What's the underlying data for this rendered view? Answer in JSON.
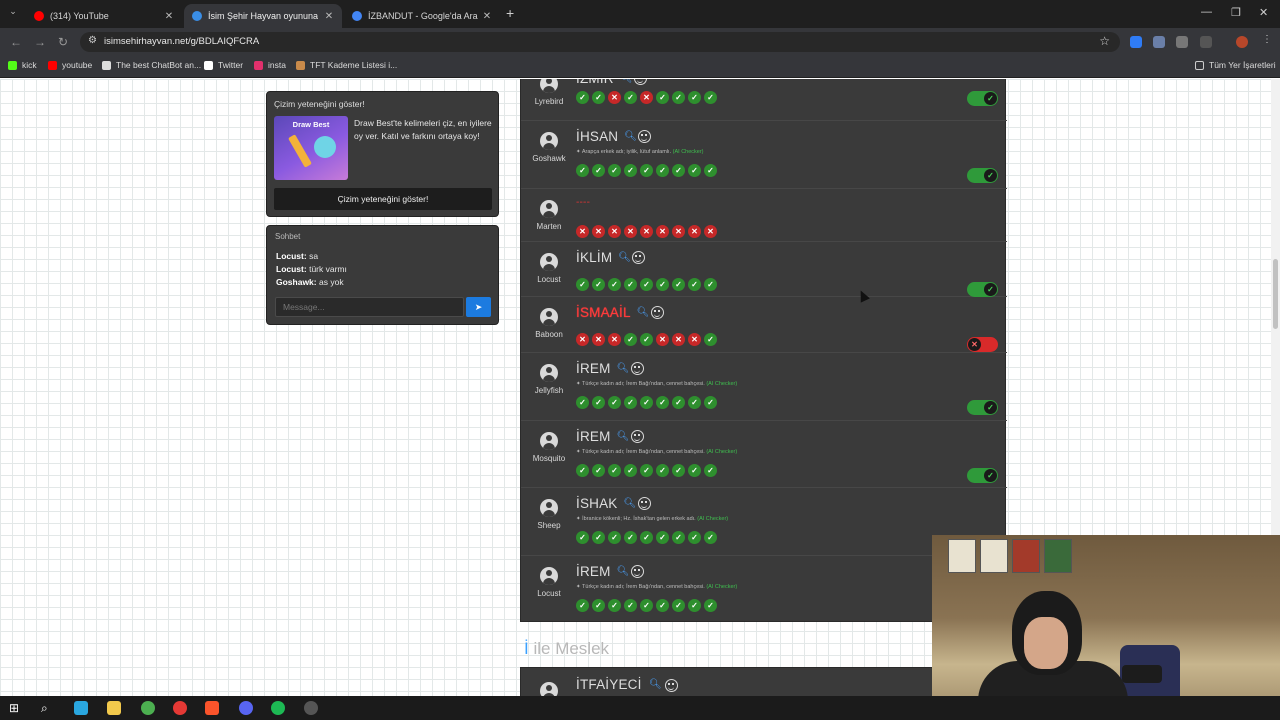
{
  "browser": {
    "tabs": [
      {
        "title": "(314) YouTube",
        "color": "#ff0000",
        "active": false
      },
      {
        "title": "İsim Şehir Hayvan oyununa katıl",
        "color": "#3a8ee6",
        "active": true
      },
      {
        "title": "İZBANDUT - Google'da Ara",
        "color": "#4285f4",
        "active": false
      }
    ],
    "new_tab": "+",
    "url": "isimsehirhayvan.net/g/BDLAIQFCRA",
    "bookmarks": [
      {
        "label": "kick",
        "color": "#53fc18"
      },
      {
        "label": "youtube",
        "color": "#ff0000"
      },
      {
        "label": "The best ChatBot an...",
        "color": "#dddddd"
      },
      {
        "label": "Twitter",
        "color": "#ffffff"
      },
      {
        "label": "insta",
        "color": "#e1306c"
      },
      {
        "label": "TFT Kademe Listesi i...",
        "color": "#c98a4a"
      }
    ],
    "all_bookmarks": "Tüm Yer İşaretleri"
  },
  "promo": {
    "title": "Çizim yeteneğini göster!",
    "image_label": "Draw Best",
    "text": "Draw Best'te kelimeleri çiz, en iyilere oy ver. Katıl ve farkını ortaya koy!",
    "button": "Çizim yeteneğini göster!"
  },
  "chat": {
    "title": "Sohbet",
    "messages": [
      {
        "user": "Locust:",
        "text": "sa"
      },
      {
        "user": "Locust:",
        "text": "türk varmı"
      },
      {
        "user": "Goshawk:",
        "text": "as yok"
      }
    ],
    "placeholder": "Message...",
    "send_icon": "send-icon"
  },
  "answers": [
    {
      "player": "Lyrebird",
      "word": "İZMİR",
      "votes": [
        "ok",
        "ok",
        "no",
        "ok",
        "no",
        "ok",
        "ok",
        "ok",
        "ok"
      ],
      "toggle": "on"
    },
    {
      "player": "Goshawk",
      "word": "İHSAN",
      "desc": "Arapça erkek adı; iyilik, lütuf anlamlı.",
      "ai": "(AI Checker)",
      "votes": [
        "ok",
        "ok",
        "ok",
        "ok",
        "ok",
        "ok",
        "ok",
        "ok",
        "ok"
      ],
      "toggle": "on"
    },
    {
      "player": "Marten",
      "word": "----",
      "empty": true,
      "votes": [
        "no",
        "no",
        "no",
        "no",
        "no",
        "no",
        "no",
        "no",
        "no"
      ],
      "toggle": ""
    },
    {
      "player": "Locust",
      "word": "İKLİM",
      "votes": [
        "ok",
        "ok",
        "ok",
        "ok",
        "ok",
        "ok",
        "ok",
        "ok",
        "ok"
      ],
      "toggle": "on"
    },
    {
      "player": "Baboon",
      "word": "İSMAAİL",
      "wrong": true,
      "votes": [
        "no",
        "no",
        "no",
        "ok",
        "ok",
        "no",
        "no",
        "no",
        "ok"
      ],
      "toggle": "off"
    },
    {
      "player": "Jellyfish",
      "word": "İREM",
      "desc": "Türkçe kadın adı; İrem Bağı'ndan, cennet bahçesi.",
      "ai": "(AI Checker)",
      "votes": [
        "ok",
        "ok",
        "ok",
        "ok",
        "ok",
        "ok",
        "ok",
        "ok",
        "ok"
      ],
      "toggle": "on"
    },
    {
      "player": "Mosquito",
      "word": "İREM",
      "desc": "Türkçe kadın adı; İrem Bağı'ndan, cennet bahçesi.",
      "ai": "(AI Checker)",
      "votes": [
        "ok",
        "ok",
        "ok",
        "ok",
        "ok",
        "ok",
        "ok",
        "ok",
        "ok"
      ],
      "toggle": "on"
    },
    {
      "player": "Sheep",
      "word": "İSHAK",
      "desc": "İbranice kökenli; Hz. İshak'tan gelen erkek adı.",
      "ai": "(AI Checker)",
      "votes": [
        "ok",
        "ok",
        "ok",
        "ok",
        "ok",
        "ok",
        "ok",
        "ok",
        "ok"
      ],
      "toggle": ""
    },
    {
      "player": "Locust",
      "word": "İREM",
      "desc": "Türkçe kadın adı; İrem Bağı'ndan, cennet bahçesi.",
      "ai": "(AI Checker)",
      "votes": [
        "ok",
        "ok",
        "ok",
        "ok",
        "ok",
        "ok",
        "ok",
        "ok",
        "ok"
      ],
      "toggle": ""
    }
  ],
  "next_section": {
    "first_letter": "İ",
    "rest": " ile Meslek"
  },
  "next_answer": {
    "word": "İTFAİYECİ"
  },
  "colors": {
    "ok": "#2e8f2e",
    "no": "#c62828",
    "accent": "#3aa0ff",
    "panel": "#3a3a3a"
  }
}
